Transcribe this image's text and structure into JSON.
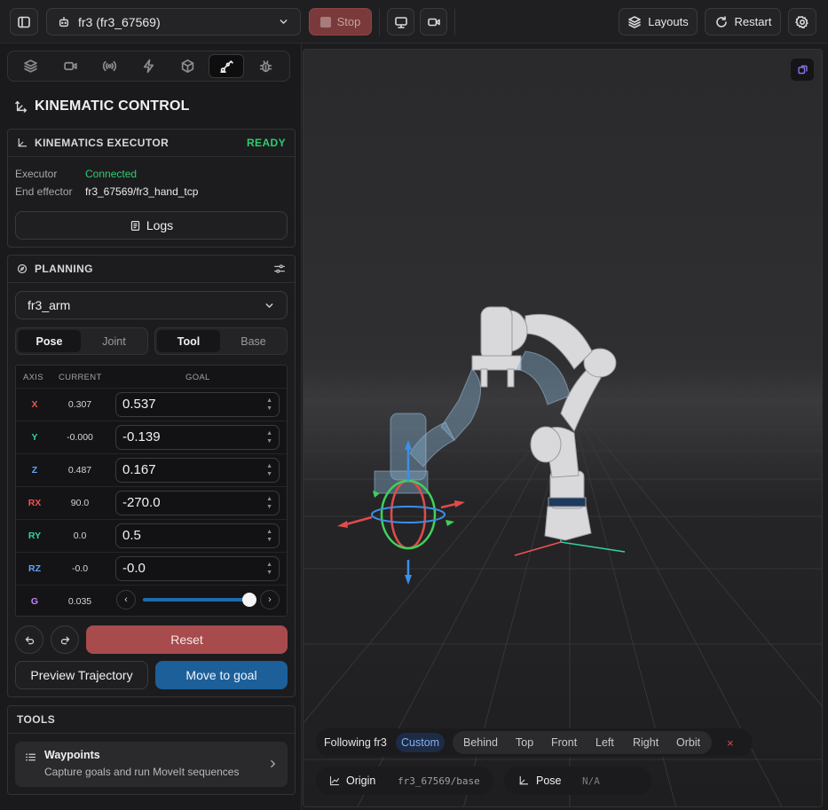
{
  "header": {
    "robot_select": "fr3 (fr3_67569)",
    "stop_label": "Stop",
    "layouts_label": "Layouts",
    "restart_label": "Restart"
  },
  "panel": {
    "title": "KINEMATIC CONTROL",
    "executor": {
      "title": "KINEMATICS EXECUTOR",
      "status": "READY",
      "executor_key": "Executor",
      "executor_value": "Connected",
      "effector_key": "End effector",
      "effector_value": "fr3_67569/fr3_hand_tcp",
      "logs_label": "Logs"
    },
    "planning": {
      "title": "PLANNING",
      "group": "fr3_arm",
      "mode_pose": "Pose",
      "mode_joint": "Joint",
      "frame_tool": "Tool",
      "frame_base": "Base",
      "col_axis": "AXIS",
      "col_current": "CURRENT",
      "col_goal": "GOAL",
      "rows": [
        {
          "axis": "X",
          "current": "0.307",
          "goal": "0.537"
        },
        {
          "axis": "Y",
          "current": "-0.000",
          "goal": "-0.139"
        },
        {
          "axis": "Z",
          "current": "0.487",
          "goal": "0.167"
        },
        {
          "axis": "RX",
          "current": "90.0",
          "goal": "-270.0"
        },
        {
          "axis": "RY",
          "current": "0.0",
          "goal": "0.5"
        },
        {
          "axis": "RZ",
          "current": "-0.0",
          "goal": "-0.0"
        }
      ],
      "gripper": {
        "axis": "G",
        "current": "0.035",
        "slider_fraction": 0.95
      },
      "reset_label": "Reset",
      "preview_label": "Preview Trajectory",
      "move_label": "Move to goal"
    },
    "tools": {
      "title": "TOOLS",
      "waypoints_title": "Waypoints",
      "waypoints_desc": "Capture goals and run MoveIt sequences"
    }
  },
  "viewport": {
    "following_label": "Following fr3",
    "views": [
      "Custom",
      "Behind",
      "Top",
      "Front",
      "Left",
      "Right",
      "Orbit"
    ],
    "active_view": "Custom",
    "origin_label": "Origin",
    "origin_value": "fr3_67569/base",
    "pose_label": "Pose",
    "pose_value": "N/A"
  },
  "colors": {
    "ready": "#2ecc71",
    "connected": "#2ecc71",
    "axis_x": "#f05252",
    "axis_y": "#34d399",
    "axis_z": "#60a5fa",
    "axis_g": "#c084fc",
    "reset": "#a84b4d",
    "move": "#1d5f99",
    "stop": "#7a3a3b"
  }
}
